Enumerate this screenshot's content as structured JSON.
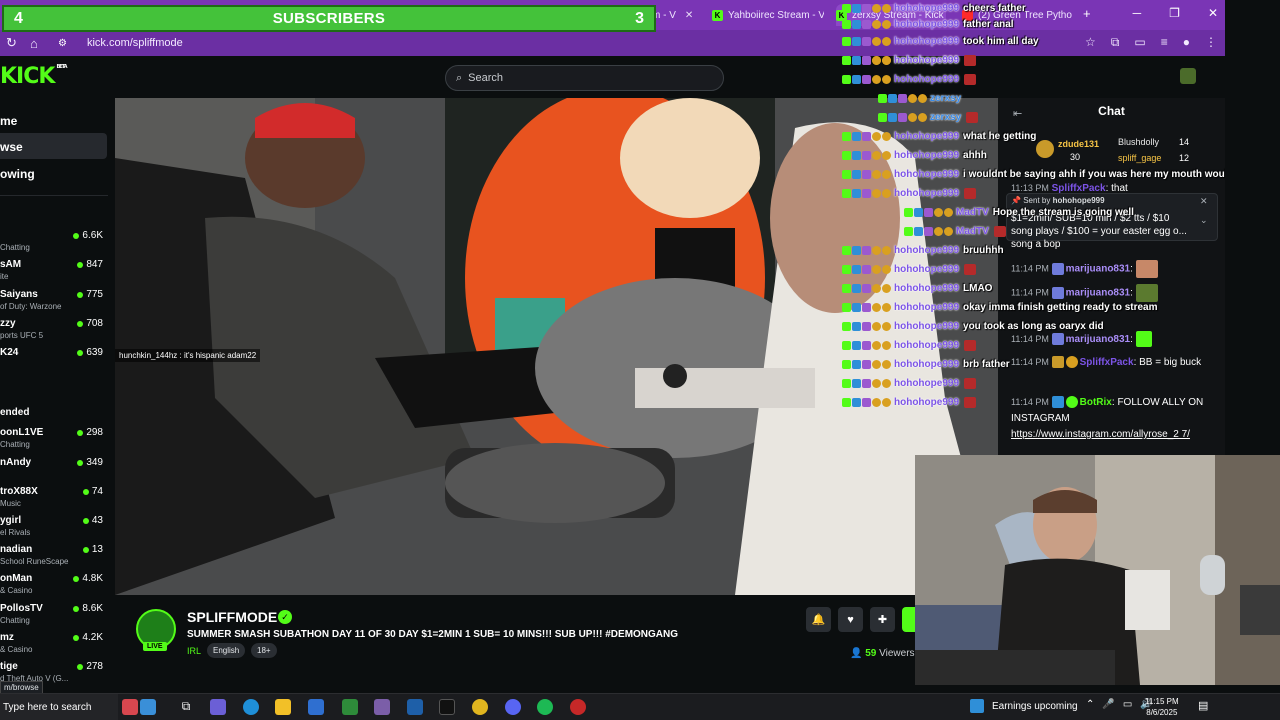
{
  "browser": {
    "tabs": [
      {
        "label": "m - V"
      },
      {
        "label": "Yahboiirec Stream - V"
      },
      {
        "label": "zerxsy Stream - Kick"
      },
      {
        "label": "(2) Green Tree Python"
      }
    ],
    "url": "kick.com/spliffmode"
  },
  "subscribers_banner": {
    "left_value": "4",
    "label": "SUBSCRIBERS",
    "right_value": "3"
  },
  "header": {
    "logo": "KICK",
    "logo_badge": "BETA",
    "search_placeholder": "Search"
  },
  "sidebar": {
    "nav": [
      {
        "label": "me"
      },
      {
        "label": "wse"
      },
      {
        "label": "owing"
      }
    ],
    "following": [
      {
        "name": "",
        "game": "Chatting",
        "viewers": "6.6K"
      },
      {
        "name": "sAM",
        "game": "ite",
        "viewers": "847"
      },
      {
        "name": "Saiyans",
        "game": "of Duty: Warzone",
        "viewers": "775"
      },
      {
        "name": "zzy",
        "game": "ports UFC 5",
        "viewers": "708"
      },
      {
        "name": "K24",
        "game": "",
        "viewers": "639"
      }
    ],
    "recommended_label": "ended",
    "recommended": [
      {
        "name": "oonL1VE",
        "game": "Chatting",
        "viewers": "298"
      },
      {
        "name": "nAndy",
        "game": "",
        "viewers": "349"
      },
      {
        "name": "troX88X",
        "game": "Music",
        "viewers": "74"
      },
      {
        "name": "ygirl",
        "game": "el Rivals",
        "viewers": "43"
      },
      {
        "name": "nadian",
        "game": "School RuneScape",
        "viewers": "13"
      },
      {
        "name": "onMan",
        "game": "& Casino",
        "viewers": "4.8K"
      },
      {
        "name": "PollosTV",
        "game": "Chatting",
        "viewers": "8.6K"
      },
      {
        "name": "mz",
        "game": "& Casino",
        "viewers": "4.2K"
      },
      {
        "name": "tige",
        "game": "d Theft Auto V (G...",
        "viewers": "278"
      }
    ],
    "status_url": "m/browse"
  },
  "video": {
    "overlay_text": "hunchkin_144hz : it's hispanic adam22"
  },
  "overlay_chat": [
    {
      "user": "hohohope999",
      "msg": "cheers father"
    },
    {
      "user": "hohohope999",
      "msg": "father anal"
    },
    {
      "user": "hohohope999",
      "msg": ""
    },
    {
      "user": "hohohope999",
      "msg": "took him all day"
    },
    {
      "user": "hohohope999",
      "msg": ""
    },
    {
      "user": "hohohope999",
      "msg": ""
    },
    {
      "user": "zerxsy",
      "msg": ""
    },
    {
      "user": "zerxsy",
      "msg": ""
    },
    {
      "user": "hohohope999",
      "msg": "what he getting"
    },
    {
      "user": "hohohope999",
      "msg": "ahhh"
    },
    {
      "user": "hohohope999",
      "msg": "i wouldnt be saying ahh if you was here my mouth would be full"
    },
    {
      "user": "hohohope999",
      "msg": ""
    },
    {
      "user": "MadTV",
      "msg": "Hope the stream is going well"
    },
    {
      "user": "MadTV",
      "msg": ""
    },
    {
      "user": "hohohope999",
      "msg": "bruuhhh"
    },
    {
      "user": "hohohope999",
      "msg": ""
    },
    {
      "user": "hohohope999",
      "msg": "LMAO"
    },
    {
      "user": "hohohope999",
      "msg": "okay imma finish getting ready to stream"
    },
    {
      "user": "hohohope999",
      "msg": "you took as long as oaryx did"
    },
    {
      "user": "hohohope999",
      "msg": ""
    },
    {
      "user": "hohohope999",
      "msg": "brb father"
    },
    {
      "user": "hohohope999",
      "msg": ""
    },
    {
      "user": "hohohope999",
      "msg": ""
    }
  ],
  "stream": {
    "name": "SPLIFFMODE",
    "live": "LIVE",
    "title": "SUMMER SMASH SUBATHON DAY 11 OF 30 DAY $1=2MIN 1 SUB= 10 MINS!!! SUB UP!!! #DEMONGANG",
    "category": "IRL",
    "tags": [
      "English",
      "18+"
    ],
    "viewers_count": "59",
    "viewers_label": "Viewers"
  },
  "chat": {
    "title": "Chat",
    "leaderboard": [
      {
        "name": "zdude131",
        "count": "30"
      },
      {
        "name": "Blushdolly",
        "count": "14"
      },
      {
        "name": "spliff_gage",
        "count": "12"
      }
    ],
    "pinned": {
      "sent_by_label": "Sent by",
      "sender": "hohohope999",
      "text": "$1=2min/ SUB=10 min / $2 tts / $10 song plays / $100 = your easter egg o..."
    },
    "partial": {
      "time": "11:13 PM",
      "user": "SpliffxPack",
      "text": "that"
    },
    "song_line": "song a bop",
    "messages": [
      {
        "time": "11:14 PM",
        "user": "marijuano831",
        "text": ""
      },
      {
        "time": "11:14 PM",
        "user": "marijuano831",
        "text": ""
      },
      {
        "time": "11:14 PM",
        "user": "marijuano831",
        "text": ""
      },
      {
        "time": "11:14 PM",
        "user": "SpliffxPack",
        "text": "BB = big buck"
      },
      {
        "time": "11:14 PM",
        "user": "BotRix",
        "text": "FOLLOW ALLY ON INSTAGRAM",
        "link": "https://www.instagram.com/allyrose_2 7/"
      }
    ]
  },
  "taskbar": {
    "search_placeholder": "Type here to search",
    "news": "Earnings upcoming",
    "time": "11:15 PM",
    "date": "8/6/2025"
  },
  "colors": {
    "kick_green": "#53fc18",
    "browser_purple": "#7a35b5",
    "overlay_user": "#7c54e6"
  }
}
